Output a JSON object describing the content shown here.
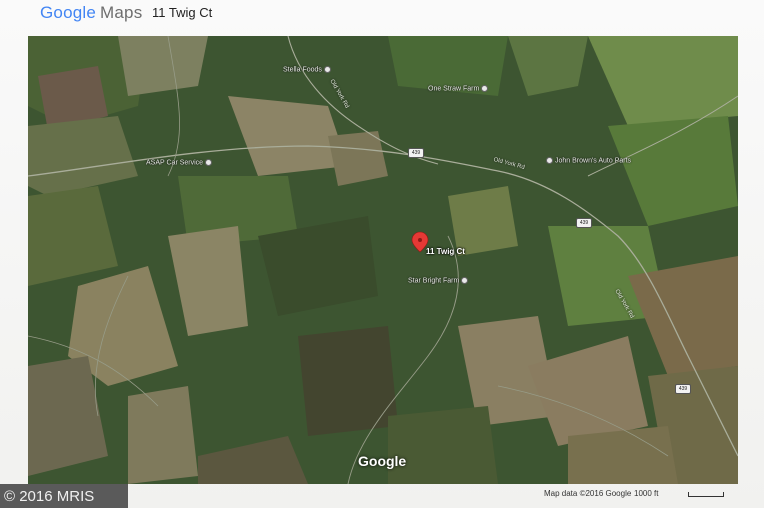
{
  "header": {
    "logo_google": "Google",
    "logo_maps": "Maps",
    "address": "11 Twig Ct"
  },
  "map": {
    "pin_label": "11 Twig Ct",
    "pois": [
      {
        "name": "Stella Foods",
        "key": "stella"
      },
      {
        "name": "One Straw Farm",
        "key": "onestraw"
      },
      {
        "name": "ASAP Car Service",
        "key": "asap"
      },
      {
        "name": "John Brown's Auto Parts",
        "key": "jbrown"
      },
      {
        "name": "Star Bright Farm",
        "key": "starbright"
      }
    ],
    "roads": {
      "old_york_a": "Old York Rd",
      "old_york_b": "Old York Rd",
      "old_york_c": "Old York Rd",
      "shield_1": "439",
      "shield_2": "439",
      "shield_3": "439"
    },
    "watermark": "Google",
    "pin_color": "#e53935"
  },
  "footer": {
    "map_data": "Map data ©2016 Google",
    "scale": "1000 ft"
  },
  "badge": {
    "text": "© 2016 MRIS"
  }
}
